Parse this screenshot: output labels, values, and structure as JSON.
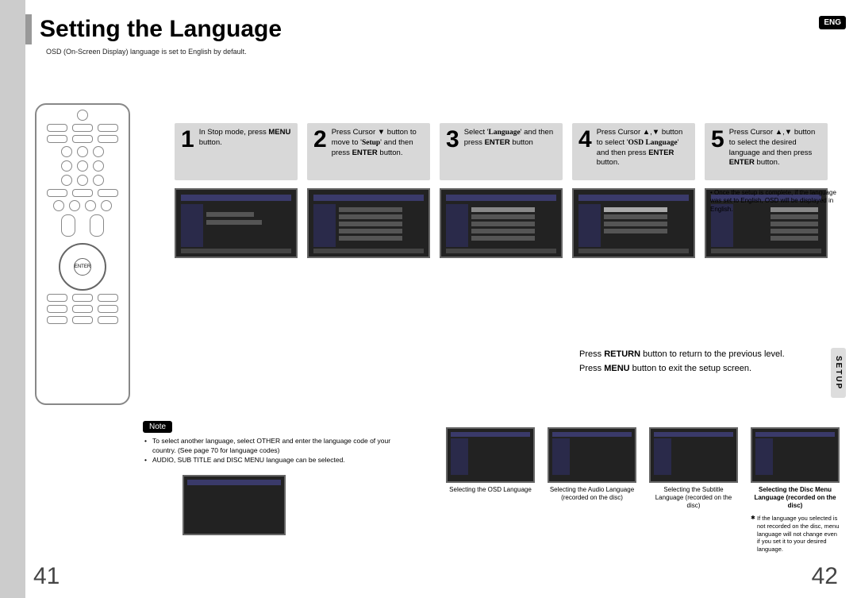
{
  "header": {
    "title": "Setting the Language",
    "subtitle": "OSD (On-Screen Display) language is set to English by default.",
    "lang_badge": "ENG"
  },
  "steps": [
    {
      "num": "1",
      "html": "In Stop mode, press <b>MENU</b> button."
    },
    {
      "num": "2",
      "html": "Press Cursor ▼ button to move to '<b class='serif'>Setup</b>' and then press <b>ENTER</b> button."
    },
    {
      "num": "3",
      "html": "Select '<b class='serif'>Language</b>' and then press <b>ENTER</b> button"
    },
    {
      "num": "4",
      "html": "Press Cursor ▲,▼ button to select '<b class='serif'>OSD Language</b>' and then press <b>ENTER</b> button."
    },
    {
      "num": "5",
      "html": "Press Cursor ▲,▼ button to select the desired language and then press <b>ENTER</b> button."
    }
  ],
  "post_note": "Once the setup is complete, if the language was set to English, OSD will be displayed in English.",
  "info": {
    "line1_pre": "Press ",
    "line1_b": "RETURN",
    "line1_post": " button to return to the previous level.",
    "line2_pre": "Press ",
    "line2_b": "MENU",
    "line2_post": " button to exit the setup screen."
  },
  "setup_tab": "SETUP",
  "note": {
    "badge": "Note",
    "items": [
      "To select another language, select OTHER and enter the language code of your country. (See page 70 for language codes)",
      "AUDIO, SUB TITLE and DISC MENU language can be selected."
    ]
  },
  "bottom_captions": [
    "Selecting the OSD Language",
    "Selecting the Audio Language (recorded on the disc)",
    "Selecting the Subtitle Language (recorded on the disc)",
    "Selecting the Disc Menu Language (recorded on the disc)"
  ],
  "disc_note": "If the language you selected is not recorded on the disc, menu language will not change even if you set it to your desired language.",
  "pages": {
    "left": "41",
    "right": "42"
  }
}
